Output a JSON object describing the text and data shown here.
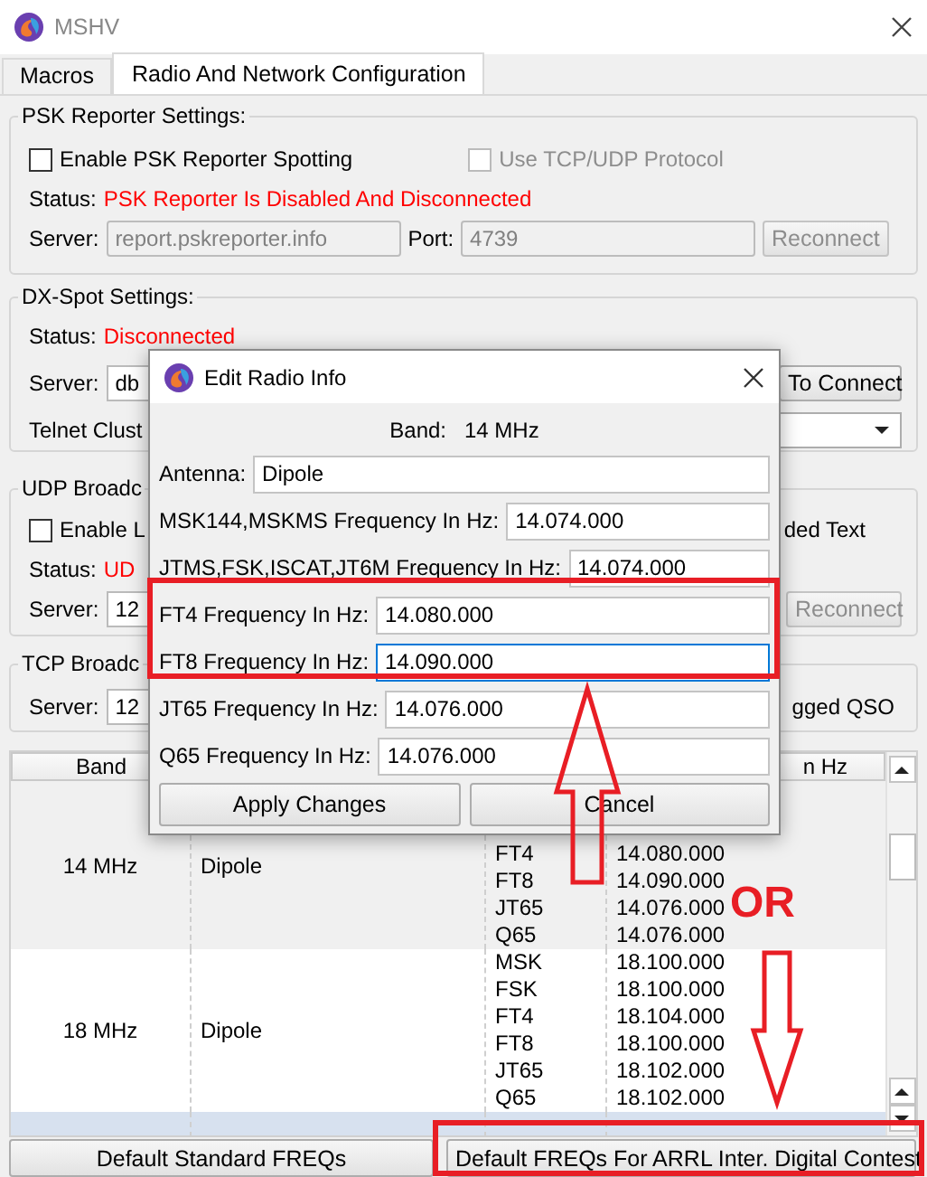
{
  "window": {
    "title": "MSHV"
  },
  "tabs": [
    {
      "label": "Macros",
      "selected": false
    },
    {
      "label": "Radio And Network Configuration",
      "selected": true
    }
  ],
  "psk_reporter": {
    "title": "PSK Reporter Settings:",
    "enable": {
      "label": "Enable PSK Reporter Spotting",
      "checked": false,
      "disabled": false
    },
    "protocol": {
      "label": "Use TCP/UDP Protocol",
      "checked": false,
      "disabled": true
    },
    "status_label": "Status:",
    "status": "PSK Reporter Is Disabled And Disconnected",
    "server_label": "Server:",
    "server": "report.pskreporter.info",
    "port_label": "Port:",
    "port": "4739",
    "inputs_disabled": true,
    "button": "Reconnect",
    "button_disabled": true
  },
  "dx_spot": {
    "title": "DX-Spot Settings:",
    "status_label": "Status:",
    "status": "Disconnected",
    "server_label": "Server:",
    "server": "db",
    "button": "To Connect",
    "cluster_label": "Telnet Clust"
  },
  "udp_broadcast": {
    "title": "UDP Broadc",
    "enable": {
      "label": "Enable L",
      "checked": false,
      "disabled": false
    },
    "option_tail": "ded Text",
    "status_label": "Status:",
    "status": "UD",
    "server_label": "Server:",
    "server": "12",
    "button": "Reconnect",
    "button_disabled": true
  },
  "tcp_broadcast": {
    "title": "TCP Broadc",
    "server_label": "Server:",
    "server": "12",
    "option_tail": "gged QSO"
  },
  "table": {
    "columns": [
      "Band",
      "n Hz"
    ],
    "rows": [
      {
        "band": "14 MHz",
        "antenna": "Dipole",
        "modes": [
          "FT4",
          "FT8",
          "JT65",
          "Q65"
        ],
        "frequencies": [
          "14.080.000",
          "14.090.000",
          "14.076.000",
          "14.076.000"
        ],
        "selected": false
      },
      {
        "band": "18 MHz",
        "antenna": "Dipole",
        "modes": [
          "MSK",
          "FSK",
          "FT4",
          "FT8",
          "JT65",
          "Q65"
        ],
        "frequencies": [
          "18.100.000",
          "18.100.000",
          "18.104.000",
          "18.100.000",
          "18.102.000",
          "18.102.000"
        ],
        "selected": false
      },
      {
        "selected": true
      }
    ]
  },
  "buttons": [
    "Default Standard FREQs",
    "Default FREQs For ARRL Inter. Digital Contest"
  ],
  "dialog": {
    "title": "Edit Radio Info",
    "band_label": "Band:",
    "band": "14 MHz",
    "fields": [
      {
        "label": "Antenna:",
        "value": "Dipole",
        "focused": false
      },
      {
        "label": "MSK144,MSKMS Frequency In Hz:",
        "value": "14.074.000",
        "focused": false
      },
      {
        "label": "JTMS,FSK,ISCAT,JT6M Frequency In Hz:",
        "value": "14.074.000",
        "focused": false
      },
      {
        "label": "FT4 Frequency In Hz:",
        "value": "14.080.000",
        "focused": false
      },
      {
        "label": "FT8 Frequency In Hz:",
        "value": "14.090.000",
        "focused": true
      },
      {
        "label": "JT65 Frequency In Hz:",
        "value": "14.076.000",
        "focused": false
      },
      {
        "label": "Q65 Frequency In Hz:",
        "value": "14.076.000",
        "focused": false
      }
    ],
    "buttons": [
      "Apply Changes",
      "Cancel"
    ]
  },
  "annotation": {
    "text": "OR"
  }
}
